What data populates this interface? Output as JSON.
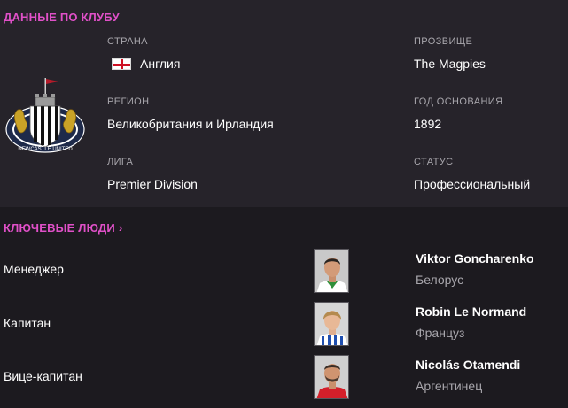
{
  "club": {
    "section_title": "ДАННЫЕ ПО КЛУБУ",
    "fields": {
      "country_label": "СТРАНА",
      "country_value": "Англия",
      "nickname_label": "ПРОЗВИЩЕ",
      "nickname_value": "The Magpies",
      "region_label": "РЕГИОН",
      "region_value": "Великобритания и Ирландия",
      "founded_label": "ГОД ОСНОВАНИЯ",
      "founded_value": "1892",
      "league_label": "ЛИГА",
      "league_value": "Premier Division",
      "status_label": "СТАТУС",
      "status_value": "Профессиональный"
    },
    "crest_icon": "newcastle-united-crest",
    "flag_icon": "england-flag-icon"
  },
  "people": {
    "section_title": "КЛЮЧЕВЫЕ ЛЮДИ",
    "chevron": "›",
    "rows": [
      {
        "role": "Менеджер",
        "name": "Viktor Goncharenko",
        "nationality": "Белорус",
        "kit": "green-white"
      },
      {
        "role": "Капитан",
        "name": "Robin Le Normand",
        "nationality": "Француз",
        "kit": "blue-white-stripes"
      },
      {
        "role": "Вице-капитан",
        "name": "Nicolás Otamendi",
        "nationality": "Аргентинец",
        "kit": "red"
      }
    ]
  },
  "colors": {
    "accent": "#e050c8",
    "panel_bg": "#26232a",
    "page_bg": "#1c1a1f",
    "muted_text": "#a8a6ac"
  }
}
